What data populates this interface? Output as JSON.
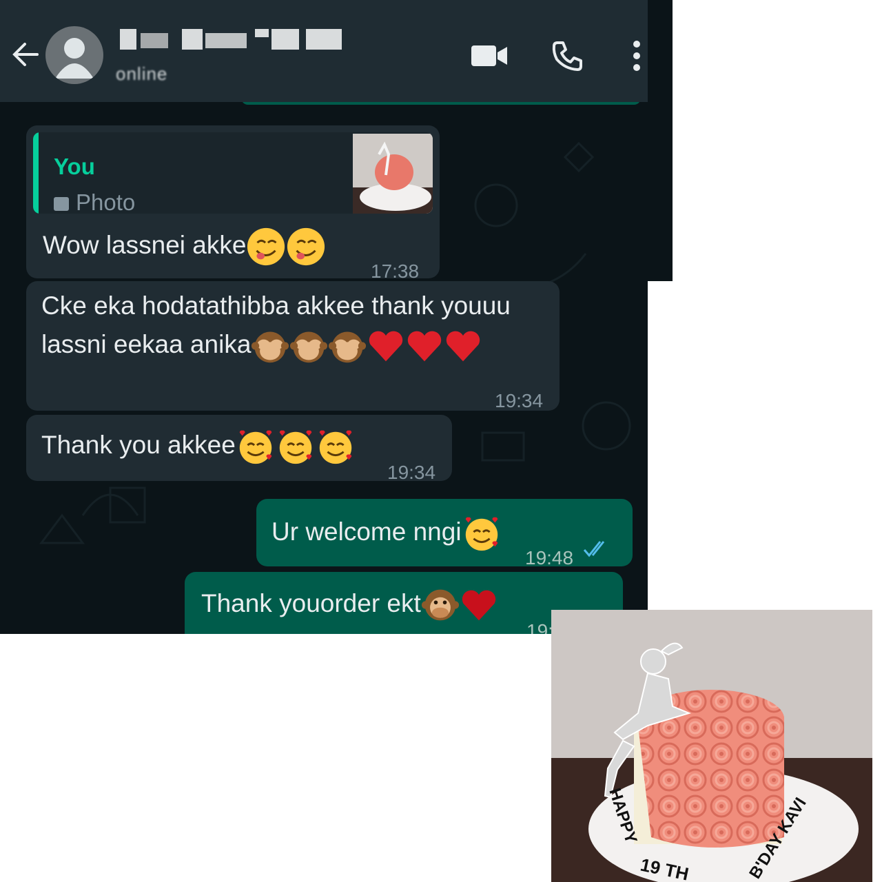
{
  "header": {
    "contact_status": "online",
    "icons": [
      "back-arrow-icon",
      "avatar-icon",
      "video-call-icon",
      "phone-icon",
      "more-vert-icon"
    ]
  },
  "messages": [
    {
      "direction": "in",
      "quote": {
        "author": "You",
        "type_label": "Photo"
      },
      "text": "Wow lassnei akke",
      "emojis": [
        "yum-face",
        "yum-face"
      ],
      "time": "17:38"
    },
    {
      "direction": "in",
      "line1": "Cke eka hodatathibba akkee thank youuu",
      "line2": "lassni eekaa anika",
      "emojis": [
        "see-no-evil-monkey",
        "see-no-evil-monkey",
        "see-no-evil-monkey",
        "red-heart",
        "red-heart",
        "red-heart"
      ],
      "time": "19:34"
    },
    {
      "direction": "in",
      "text": "Thank you akkee",
      "emojis": [
        "smiling-face-with-hearts",
        "smiling-face-with-hearts",
        "smiling-face-with-hearts"
      ],
      "time": "19:34"
    },
    {
      "direction": "out",
      "text": "Ur welcome nngi",
      "emojis": [
        "smiling-face-with-hearts"
      ],
      "time": "19:48",
      "status": "read"
    },
    {
      "direction": "out",
      "text": "Thank youorder ekt",
      "emojis": [
        "speak-no-evil-monkey",
        "red-heart"
      ],
      "time": "19:"
    }
  ],
  "cake": {
    "board_text_left": "HAPPY",
    "board_text_bottom": "19 TH",
    "board_text_right": "B'DAY KAVI"
  },
  "colors": {
    "chat_bg": "#0b1418",
    "header_bg": "#1f2c33",
    "incoming_bubble": "#202c33",
    "outgoing_bubble": "#005c4b",
    "accent": "#06cf9c",
    "read_tick": "#53bdeb"
  }
}
